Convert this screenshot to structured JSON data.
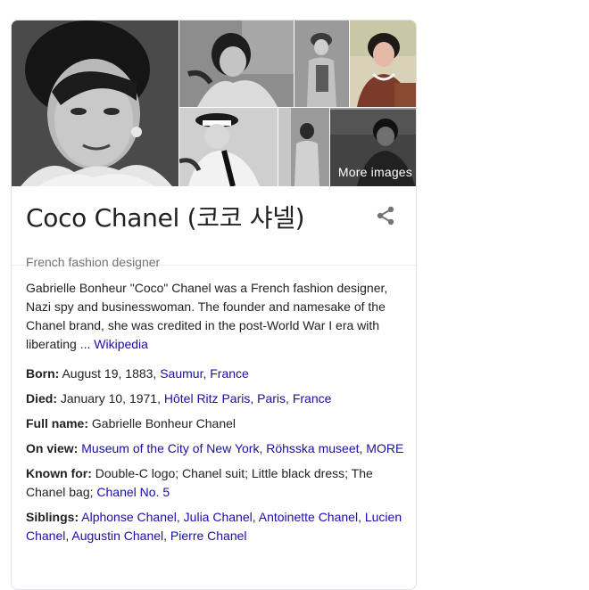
{
  "gallery": {
    "more_images_label": "More images"
  },
  "header": {
    "title": "Coco Chanel (코코 샤넬)",
    "subtitle": "French fashion designer",
    "share_icon": "share-icon"
  },
  "description": {
    "text": "Gabrielle Bonheur \"Coco\" Chanel was a French fashion designer, Nazi spy and businesswoman. The founder and namesake of the Chanel brand, she was credited in the post-World War I era with liberating ...",
    "source_link": "Wikipedia"
  },
  "facts": {
    "born": {
      "label": "Born:",
      "value": "August 19, 1883,",
      "links": [
        "Saumur, France"
      ]
    },
    "died": {
      "label": "Died:",
      "value": "January 10, 1971,",
      "links": [
        "Hôtel Ritz Paris",
        "Paris",
        "France"
      ]
    },
    "full_name": {
      "label": "Full name:",
      "value": "Gabrielle Bonheur Chanel"
    },
    "on_view": {
      "label": "On view:",
      "links": [
        "Museum of the City of New York",
        "Röhsska museet",
        "MORE"
      ]
    },
    "known_for": {
      "label": "Known for:",
      "value": "Double-C logo; Chanel suit; Little black dress; The Chanel bag;",
      "links": [
        "Chanel No. 5"
      ]
    },
    "siblings": {
      "label": "Siblings:",
      "links": [
        "Alphonse Chanel",
        "Julia Chanel",
        "Antoinette Chanel",
        "Lucien Chanel",
        "Augustin Chanel",
        "Pierre Chanel"
      ]
    }
  },
  "colors": {
    "link": "#1a0dab",
    "text": "#222222",
    "muted": "#70757a",
    "border": "#dfe1e5"
  }
}
